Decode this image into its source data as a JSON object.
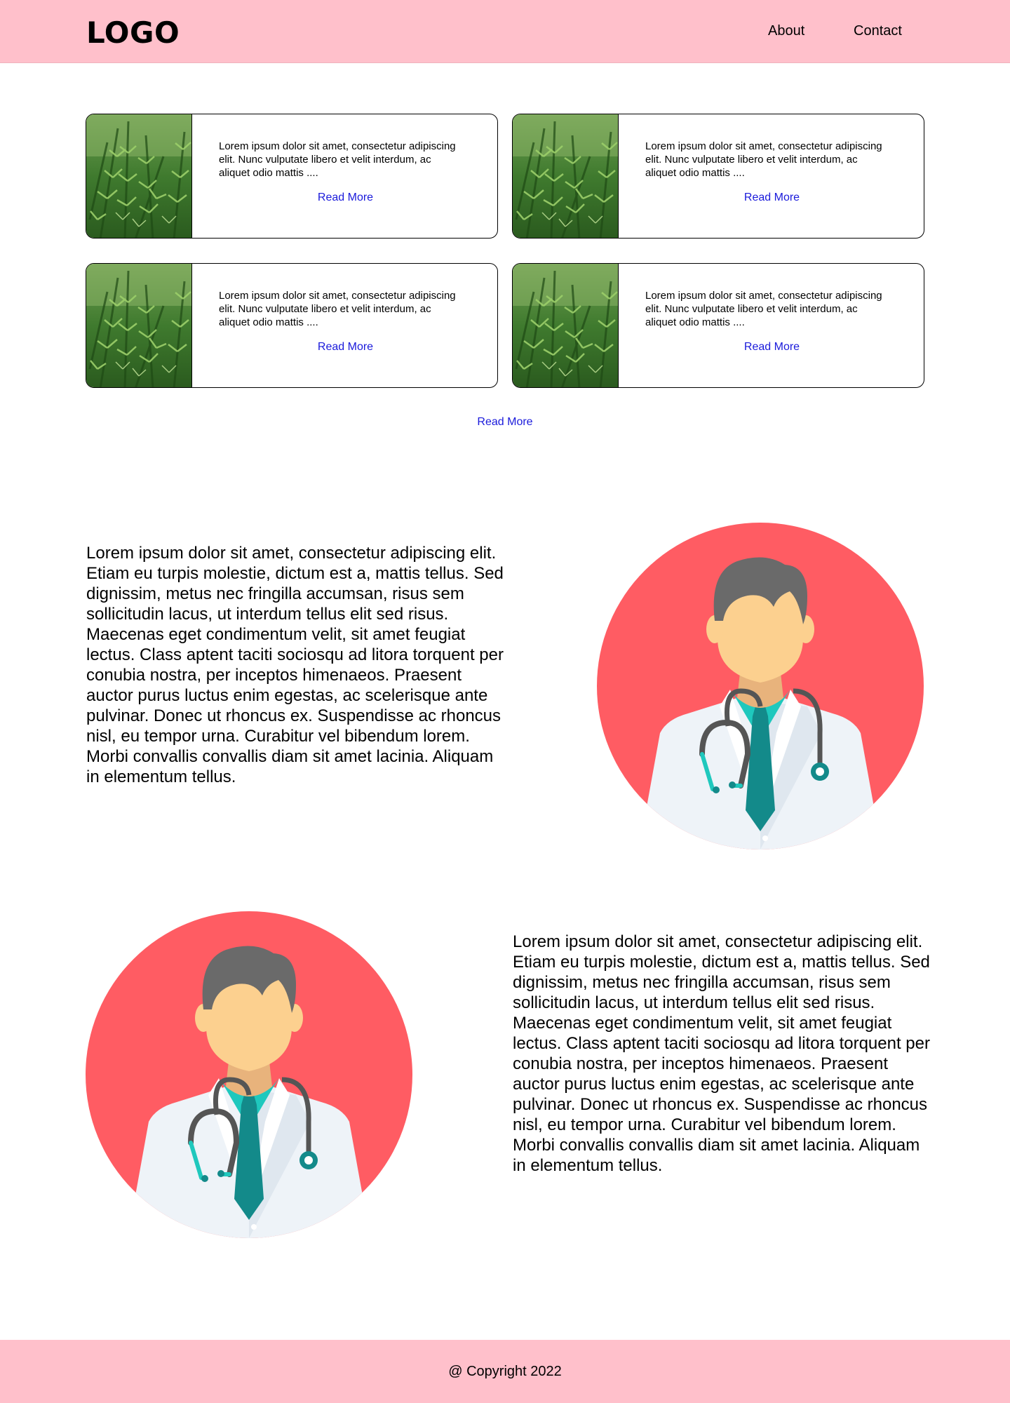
{
  "header": {
    "logo": "LOGO",
    "nav": {
      "about": "About",
      "contact": "Contact"
    }
  },
  "colors": {
    "header_bg": "#ffc0cb",
    "link": "#1a1adb",
    "avatar_bg": "#ff5c63",
    "tie_accent": "#1fc8bd"
  },
  "cards": [
    {
      "text": "Lorem ipsum dolor sit amet, consectetur adipiscing elit. Nunc vulputate libero et velit interdum, ac aliquet odio mattis ....",
      "link": "Read More",
      "image_icon": "rosemary-plant-photo"
    },
    {
      "text": "Lorem ipsum dolor sit amet, consectetur adipiscing elit. Nunc vulputate libero et velit interdum, ac aliquet odio mattis ....",
      "link": "Read More",
      "image_icon": "rosemary-plant-photo"
    },
    {
      "text": "Lorem ipsum dolor sit amet, consectetur adipiscing elit. Nunc vulputate libero et velit interdum, ac aliquet odio mattis ....",
      "link": "Read More",
      "image_icon": "rosemary-plant-photo"
    },
    {
      "text": "Lorem ipsum dolor sit amet, consectetur adipiscing elit. Nunc vulputate libero et velit interdum, ac aliquet odio mattis ....",
      "link": "Read More",
      "image_icon": "rosemary-plant-photo"
    }
  ],
  "more_link": "Read More",
  "sections": [
    {
      "text": "Lorem ipsum dolor sit amet, consectetur adipiscing elit. Etiam eu turpis molestie, dictum est a, mattis tellus. Sed dignissim, metus nec fringilla accumsan, risus sem sollicitudin lacus, ut interdum tellus elit sed risus. Maecenas eget condimentum velit, sit amet feugiat lectus. Class aptent taciti sociosqu ad litora torquent per conubia nostra, per inceptos himenaeos. Praesent auctor purus luctus enim egestas, ac scelerisque ante pulvinar. Donec ut rhoncus ex. Suspendisse ac rhoncus nisl, eu tempor urna. Curabitur vel bibendum lorem. Morbi convallis convallis diam sit amet lacinia. Aliquam in elementum tellus.",
      "image_icon": "doctor-avatar"
    },
    {
      "text": "Lorem ipsum dolor sit amet, consectetur adipiscing elit. Etiam eu turpis molestie, dictum est a, mattis tellus. Sed dignissim, metus nec fringilla accumsan, risus sem sollicitudin lacus, ut interdum tellus elit sed risus. Maecenas eget condimentum velit, sit amet feugiat lectus. Class aptent taciti sociosqu ad litora torquent per conubia nostra, per inceptos himenaeos. Praesent auctor purus luctus enim egestas, ac scelerisque ante pulvinar. Donec ut rhoncus ex. Suspendisse ac rhoncus nisl, eu tempor urna. Curabitur vel bibendum lorem. Morbi convallis convallis diam sit amet lacinia. Aliquam in elementum tellus.",
      "image_icon": "doctor-avatar"
    }
  ],
  "footer": {
    "copyright": "@ Copyright 2022"
  }
}
